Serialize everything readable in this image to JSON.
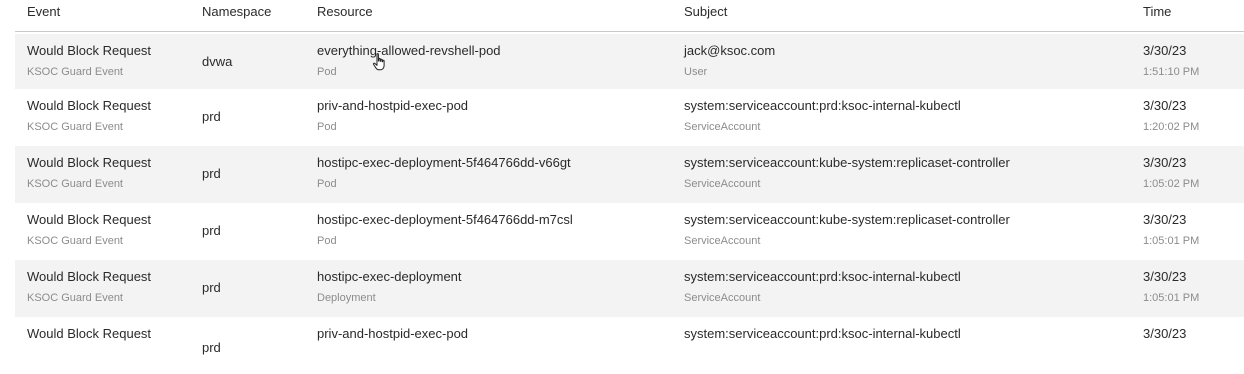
{
  "columns": {
    "event": "Event",
    "namespace": "Namespace",
    "resource": "Resource",
    "subject": "Subject",
    "time": "Time"
  },
  "rows": [
    {
      "event": "Would Block Request",
      "event_type": "KSOC Guard Event",
      "namespace": "dvwa",
      "resource": "everything-allowed-revshell-pod",
      "resource_kind": "Pod",
      "subject": "jack@ksoc.com",
      "subject_kind": "User",
      "date": "3/30/23",
      "time": "1:51:10 PM"
    },
    {
      "event": "Would Block Request",
      "event_type": "KSOC Guard Event",
      "namespace": "prd",
      "resource": "priv-and-hostpid-exec-pod",
      "resource_kind": "Pod",
      "subject": "system:serviceaccount:prd:ksoc-internal-kubectl",
      "subject_kind": "ServiceAccount",
      "date": "3/30/23",
      "time": "1:20:02 PM"
    },
    {
      "event": "Would Block Request",
      "event_type": "KSOC Guard Event",
      "namespace": "prd",
      "resource": "hostipc-exec-deployment-5f464766dd-v66gt",
      "resource_kind": "Pod",
      "subject": "system:serviceaccount:kube-system:replicaset-controller",
      "subject_kind": "ServiceAccount",
      "date": "3/30/23",
      "time": "1:05:02 PM"
    },
    {
      "event": "Would Block Request",
      "event_type": "KSOC Guard Event",
      "namespace": "prd",
      "resource": "hostipc-exec-deployment-5f464766dd-m7csl",
      "resource_kind": "Pod",
      "subject": "system:serviceaccount:kube-system:replicaset-controller",
      "subject_kind": "ServiceAccount",
      "date": "3/30/23",
      "time": "1:05:01 PM"
    },
    {
      "event": "Would Block Request",
      "event_type": "KSOC Guard Event",
      "namespace": "prd",
      "resource": "hostipc-exec-deployment",
      "resource_kind": "Deployment",
      "subject": "system:serviceaccount:prd:ksoc-internal-kubectl",
      "subject_kind": "ServiceAccount",
      "date": "3/30/23",
      "time": "1:05:01 PM"
    },
    {
      "event": "Would Block Request",
      "event_type": "",
      "namespace": "prd",
      "resource": "priv-and-hostpid-exec-pod",
      "resource_kind": "",
      "subject": "system:serviceaccount:prd:ksoc-internal-kubectl",
      "subject_kind": "",
      "date": "3/30/23",
      "time": ""
    }
  ],
  "cursor_icon": "pointer-hand-icon"
}
